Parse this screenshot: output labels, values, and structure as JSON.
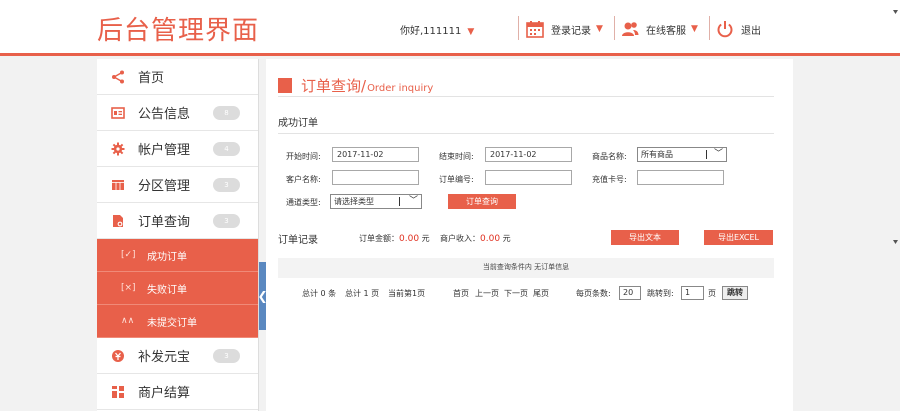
{
  "header": {
    "logo": "后台管理界面",
    "greeting": "你好,111111",
    "login_records": "登录记录",
    "online_service": "在线客服",
    "logout": "退出",
    "caret": "▼"
  },
  "sidebar": {
    "items": [
      {
        "label": "首页",
        "icon": "share-icon"
      },
      {
        "label": "公告信息",
        "icon": "notice-icon",
        "badge": "8"
      },
      {
        "label": "帐户管理",
        "icon": "gear-icon",
        "badge": "4"
      },
      {
        "label": "分区管理",
        "icon": "grid-icon",
        "badge": "3"
      },
      {
        "label": "订单查询",
        "icon": "order-icon",
        "badge": "3"
      }
    ],
    "sub_items": [
      {
        "label": "成功订单",
        "icon": "check-box-icon",
        "glyph": "[✓]"
      },
      {
        "label": "失败订单",
        "icon": "cross-box-icon",
        "glyph": "[×]"
      },
      {
        "label": "未提交订单",
        "icon": "wave-icon",
        "glyph": "∧∧"
      }
    ],
    "items_after": [
      {
        "label": "补发元宝",
        "icon": "coin-icon",
        "badge": "3"
      },
      {
        "label": "商户结算",
        "icon": "settle-icon"
      }
    ],
    "collapse_glyph": "❮"
  },
  "main": {
    "title_zh": "订单查询/",
    "title_en": "Order inquiry",
    "section_title": "成功订单",
    "form": {
      "start_label": "开始时间:",
      "start_value": "2017-11-02",
      "end_label": "结束时间:",
      "end_value": "2017-11-02",
      "product_label": "商品名称:",
      "product_value": "所有商品",
      "customer_label": "客户名称:",
      "order_no_label": "订单编号:",
      "card_label": "充值卡号:",
      "channel_label": "通道类型:",
      "channel_value": "请选择类型",
      "query_button": "订单查询"
    },
    "records": {
      "title": "订单记录",
      "amount_label": "订单金额：",
      "amount_value": "0.00",
      "amount_unit": "元",
      "income_label": "商户收入：",
      "income_value": "0.00",
      "income_unit": "元",
      "export_text": "导出文本",
      "export_excel": "导出EXCEL",
      "empty_message": "当前查询条件内 无订单信息"
    },
    "pagination": {
      "total_items": "总计 0 条",
      "total_pages": "总计 1 页",
      "current_page": "当前第1页",
      "first": "首页",
      "prev": "上一页",
      "next": "下一页",
      "last": "尾页",
      "per_page_label": "每页条数:",
      "per_page_value": "20",
      "jump_label": "跳转到:",
      "jump_value": "1",
      "page_unit": "页",
      "go_button": "跳转"
    }
  },
  "colors": {
    "accent": "#e8604a",
    "collapse_tab": "#5a88c0",
    "amount_red": "#e03020"
  }
}
